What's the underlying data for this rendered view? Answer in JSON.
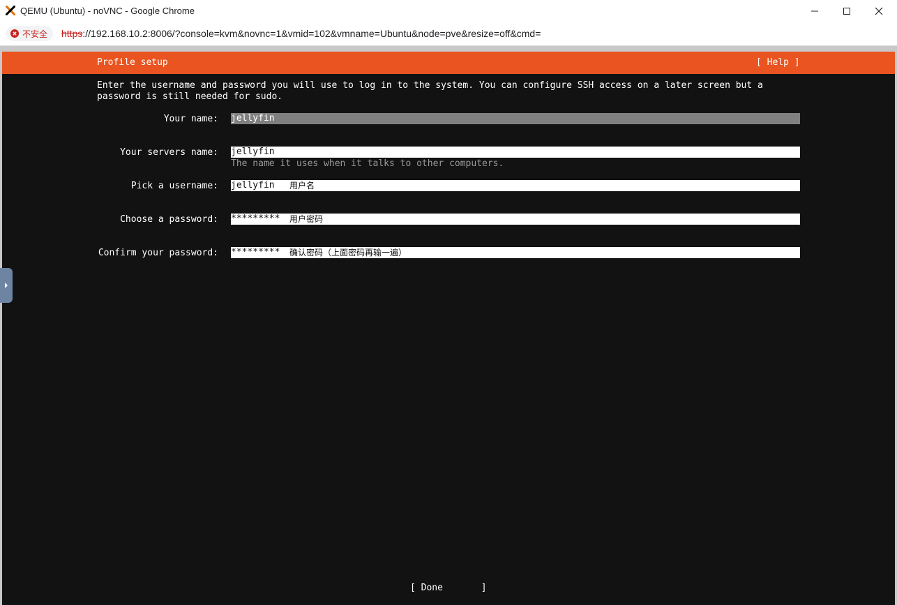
{
  "window": {
    "title": "QEMU (Ubuntu) - noVNC - Google Chrome",
    "logo_icon": "proxmox-x-logo",
    "buttons": [
      "minimize-icon",
      "maximize-icon",
      "close-icon"
    ]
  },
  "addressbar": {
    "security_label": "不安全",
    "url_scheme": "https",
    "url_rest": "://192.168.10.2:8006/?console=kvm&novnc=1&vmid=102&vmname=Ubuntu&node=pve&resize=off&cmd="
  },
  "colors": {
    "ubuntu_orange": "#e95420",
    "console_bg": "#121212",
    "focused_field": "#808080",
    "novnc_handle": "#6e84a3"
  },
  "installer": {
    "screen_title": "Profile setup",
    "help_label": "[ Help ]",
    "intro": "Enter the username and password you will use to log in to the system. You can configure SSH access on a later screen but a\npassword is still needed for sudo.",
    "fields": [
      {
        "label": "Your name:",
        "value": "jellyfin",
        "note": ""
      },
      {
        "label": "Your servers name:",
        "value": "jellyfin",
        "note": "",
        "hint": "The name it uses when it talks to other computers."
      },
      {
        "label": "Pick a username:",
        "value": "jellyfin",
        "note": "用户名"
      },
      {
        "label": "Choose a password:",
        "value": "*********",
        "note": "用户密码"
      },
      {
        "label": "Confirm your password:",
        "value": "*********",
        "note": "确认密码（上面密码再输一遍）"
      }
    ],
    "done_label": "[ Done       ]"
  }
}
